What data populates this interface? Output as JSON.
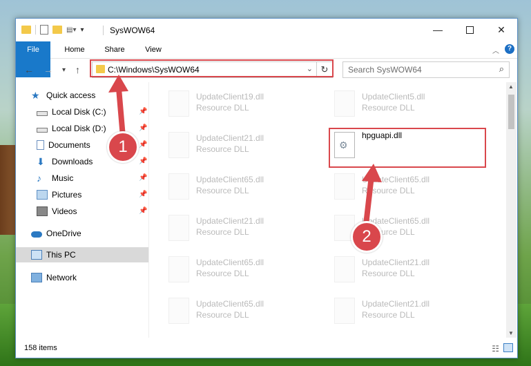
{
  "window": {
    "title": "SysWOW64",
    "controls": [
      "minimize",
      "maximize",
      "close"
    ]
  },
  "ribbon": {
    "tabs": [
      "File",
      "Home",
      "Share",
      "View"
    ]
  },
  "address": {
    "path": "C:\\Windows\\SysWOW64",
    "search_placeholder": "Search SysWOW64"
  },
  "sidebar": {
    "items": [
      {
        "label": "Quick access",
        "icon": "star-icon"
      },
      {
        "label": "Local Disk (C:)",
        "icon": "drive-icon",
        "pinned": true
      },
      {
        "label": "Local Disk (D:)",
        "icon": "drive-icon",
        "pinned": true
      },
      {
        "label": "Documents",
        "icon": "documents-icon",
        "pinned": true
      },
      {
        "label": "Downloads",
        "icon": "download-icon",
        "pinned": true
      },
      {
        "label": "Music",
        "icon": "music-icon",
        "pinned": true
      },
      {
        "label": "Pictures",
        "icon": "pictures-icon",
        "pinned": true
      },
      {
        "label": "Videos",
        "icon": "videos-icon",
        "pinned": true
      },
      {
        "label": "OneDrive",
        "icon": "cloud-icon"
      },
      {
        "label": "This PC",
        "icon": "computer-icon",
        "selected": true
      },
      {
        "label": "Network",
        "icon": "network-icon"
      }
    ]
  },
  "files": [
    {
      "name": "UpdateClient19.dll",
      "desc": "Resource DLL"
    },
    {
      "name": "UpdateClient5.dll",
      "desc": "Resource DLL"
    },
    {
      "name": "UpdateClient21.dll",
      "desc": "Resource DLL"
    },
    {
      "name": "hpguapi.dll",
      "desc": ""
    },
    {
      "name": "UpdateClient65.dll",
      "desc": "Resource DLL"
    },
    {
      "name": "UpdateClient65.dll",
      "desc": "Resource DLL"
    },
    {
      "name": "UpdateClient21.dll",
      "desc": "Resource DLL"
    },
    {
      "name": "UpdateClient65.dll",
      "desc": "Resource DLL"
    },
    {
      "name": "UpdateClient65.dll",
      "desc": "Resource DLL"
    },
    {
      "name": "UpdateClient21.dll",
      "desc": "Resource DLL"
    },
    {
      "name": "UpdateClient65.dll",
      "desc": "Resource DLL"
    },
    {
      "name": "UpdateClient21.dll",
      "desc": "Resource DLL"
    }
  ],
  "status": {
    "item_count": "158 items"
  },
  "callouts": [
    "1",
    "2"
  ],
  "colors": {
    "accent": "#1979ca",
    "highlight": "#d9474c"
  }
}
